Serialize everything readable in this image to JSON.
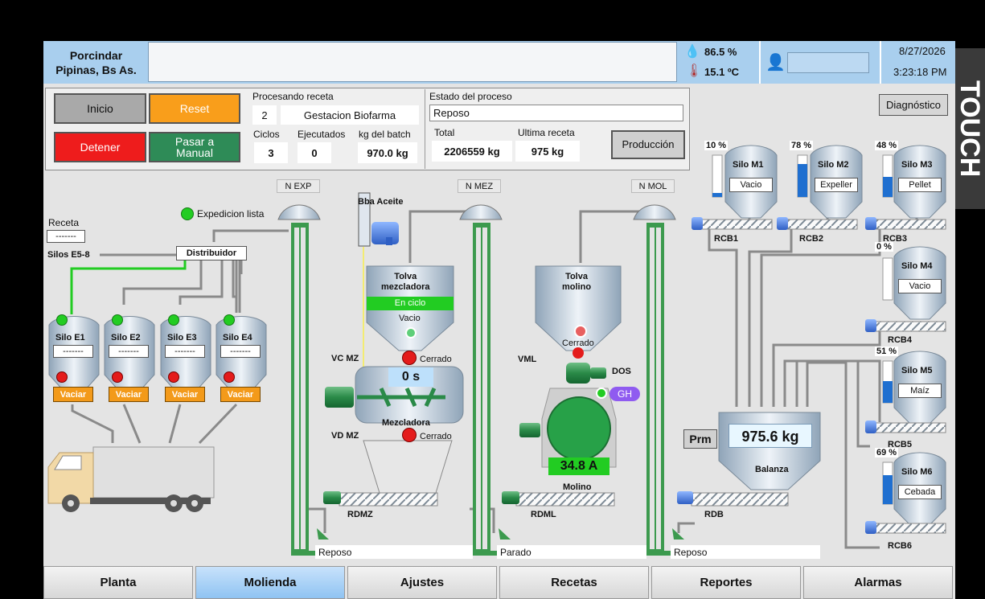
{
  "header": {
    "location": "Porcindar\nPipinas, Bs As.",
    "message": "",
    "humidity": "86.5 %",
    "temperature": "15.1 ºC",
    "user": "",
    "date": "8/27/2026",
    "time": "3:23:18 PM",
    "side_label": "TOUCH"
  },
  "controls": {
    "inicio": "Inicio",
    "reset": "Reset",
    "detener": "Detener",
    "manual": "Pasar a\nManual",
    "diagnostico": "Diagnóstico",
    "produccion": "Producción"
  },
  "recipe": {
    "title": "Procesando receta",
    "number": "2",
    "name": "Gestacion Biofarma",
    "ciclos_label": "Ciclos",
    "ciclos": "3",
    "ejecutados_label": "Ejecutados",
    "ejecutados": "0",
    "batch_label": "kg del batch",
    "batch": "970.0 kg"
  },
  "process": {
    "title": "Estado del proceso",
    "state": "Reposo",
    "total_label": "Total",
    "total": "2206559 kg",
    "ultima_label": "Ultima receta",
    "ultima": "975 kg"
  },
  "expedition": {
    "status": "Expedicion lista",
    "receta_label": "Receta",
    "receta_value": "-------",
    "silos_label": "Silos E5-8",
    "distribuidor": "Distribuidor",
    "silos": [
      {
        "name": "Silo E1",
        "value": "-------",
        "button": "Vaciar"
      },
      {
        "name": "Silo E2",
        "value": "-------",
        "button": "Vaciar"
      },
      {
        "name": "Silo E3",
        "value": "-------",
        "button": "Vaciar"
      },
      {
        "name": "Silo E4",
        "value": "-------",
        "button": "Vaciar"
      }
    ]
  },
  "elevators": {
    "exp": "N EXP",
    "mez": "N MEZ",
    "mol": "N MOL",
    "exp_status": "Reposo",
    "mez_status": "Parado",
    "mol_status": "Reposo"
  },
  "mixer": {
    "pump": "Bba Aceite",
    "hopper": "Tolva\nmezcladora",
    "cycle": "En ciclo",
    "hopper_state": "Vacio",
    "vc": "VC MZ",
    "vc_state": "Cerrado",
    "timer": "0 s",
    "name": "Mezcladora",
    "vd": "VD MZ",
    "vd_state": "Cerrado",
    "screw": "RDMZ"
  },
  "mill": {
    "hopper": "Tolva\nmolino",
    "hopper_state": "Cerrado",
    "vml": "VML",
    "dos": "DOS",
    "gh": "GH",
    "current": "34.8 A",
    "name": "Molino",
    "screw": "RDML"
  },
  "silos_m": [
    {
      "name": "Silo M1",
      "pct": "10 %",
      "level": 0.1,
      "content": "Vacio",
      "screw": "RCB1"
    },
    {
      "name": "Silo M2",
      "pct": "78 %",
      "level": 0.78,
      "content": "Expeller",
      "screw": "RCB2"
    },
    {
      "name": "Silo M3",
      "pct": "48 %",
      "level": 0.48,
      "content": "Pellet",
      "screw": "RCB3"
    },
    {
      "name": "Silo M4",
      "pct": "0 %",
      "level": 0.0,
      "content": "Vacio",
      "screw": "RCB4"
    },
    {
      "name": "Silo M5",
      "pct": "51 %",
      "level": 0.51,
      "content": "Maíz",
      "screw": "RCB5"
    },
    {
      "name": "Silo M6",
      "pct": "69 %",
      "level": 0.69,
      "content": "Cebada",
      "screw": "RCB6"
    }
  ],
  "scale": {
    "prm": "Prm",
    "weight": "975.6 kg",
    "name": "Balanza",
    "screw": "RDB"
  },
  "tabs": [
    "Planta",
    "Molienda",
    "Ajustes",
    "Recetas",
    "Reportes",
    "Alarmas"
  ],
  "active_tab": "Molienda",
  "colors": {
    "header": "#a9cfee",
    "green_pipe": "#3c9a4e",
    "orange": "#f39a1a",
    "red": "#e41b1b",
    "lime": "#22cc22",
    "purple": "#8f5bf0"
  }
}
